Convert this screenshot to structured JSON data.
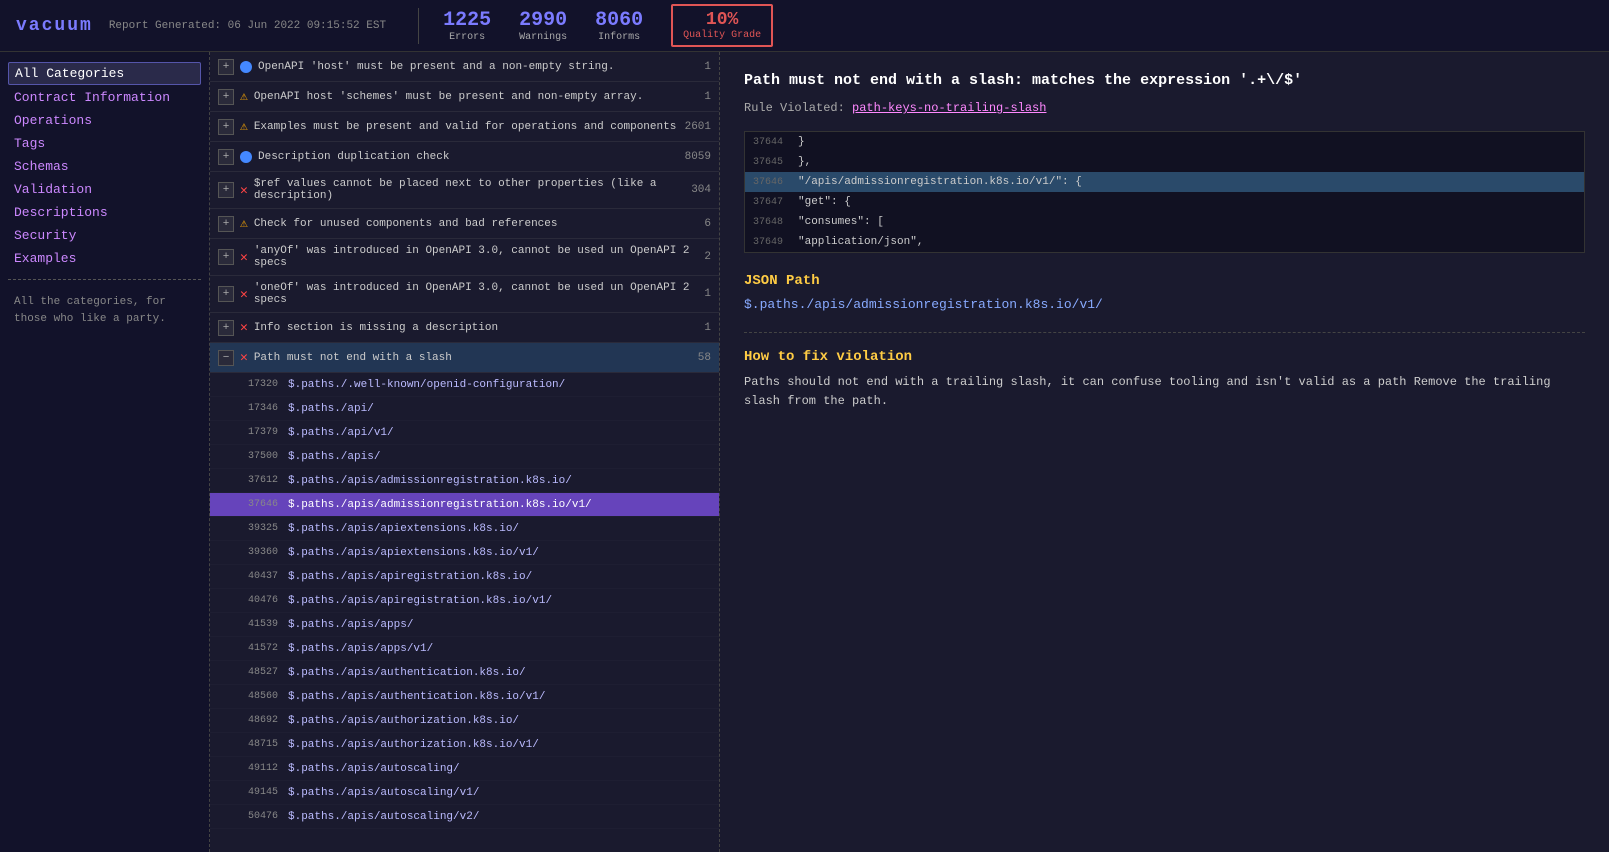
{
  "header": {
    "logo": "vacuum",
    "report_time": "Report Generated: 06 Jun 2022 09:15:52 EST",
    "stats": {
      "errors": {
        "number": "1225",
        "label": "Errors"
      },
      "warnings": {
        "number": "2990",
        "label": "Warnings"
      },
      "informs": {
        "number": "8060",
        "label": "Informs"
      },
      "quality": {
        "number": "10%",
        "label": "Quality Grade"
      }
    }
  },
  "sidebar": {
    "items": [
      {
        "id": "all-categories",
        "label": "All Categories",
        "active": true
      },
      {
        "id": "contract-information",
        "label": "Contract Information",
        "active": false
      },
      {
        "id": "operations",
        "label": "Operations",
        "active": false
      },
      {
        "id": "tags",
        "label": "Tags",
        "active": false
      },
      {
        "id": "schemas",
        "label": "Schemas",
        "active": false
      },
      {
        "id": "validation",
        "label": "Validation",
        "active": false
      },
      {
        "id": "descriptions",
        "label": "Descriptions",
        "active": false
      },
      {
        "id": "security",
        "label": "Security",
        "active": false
      },
      {
        "id": "examples",
        "label": "Examples",
        "active": false
      }
    ],
    "description": "All the categories, for those who like a party."
  },
  "rules": [
    {
      "id": "rule-host",
      "icon": "circle-blue",
      "text": "OpenAPI 'host' must be present and a non-empty string.",
      "count": "1",
      "expanded": false
    },
    {
      "id": "rule-schemes",
      "icon": "warn",
      "text": "OpenAPI host 'schemes' must be present and non-empty array.",
      "count": "1",
      "expanded": false
    },
    {
      "id": "rule-examples",
      "icon": "warn",
      "text": "Examples must be present and valid for operations and components",
      "count": "2601",
      "expanded": false
    },
    {
      "id": "rule-description-dup",
      "icon": "circle-blue",
      "text": "Description duplication check",
      "count": "8059",
      "expanded": false
    },
    {
      "id": "rule-ref",
      "icon": "error",
      "text": "$ref values cannot be placed next to other properties (like a description)",
      "count": "304",
      "expanded": false
    },
    {
      "id": "rule-unused",
      "icon": "warn",
      "text": "Check for unused components and bad references",
      "count": "6",
      "expanded": false
    },
    {
      "id": "rule-anyof",
      "icon": "error",
      "text": "'anyOf' was introduced in OpenAPI 3.0, cannot be used un OpenAPI 2 specs",
      "count": "2",
      "expanded": false
    },
    {
      "id": "rule-oneof",
      "icon": "error",
      "text": "'oneOf' was introduced in OpenAPI 3.0, cannot be used un OpenAPI 2 specs",
      "count": "1",
      "expanded": false
    },
    {
      "id": "rule-info-desc",
      "icon": "error",
      "text": "Info section is missing a description",
      "count": "1",
      "expanded": false
    },
    {
      "id": "rule-slash",
      "icon": "error",
      "text": "Path must not end with a slash",
      "count": "58",
      "expanded": true,
      "active": true
    }
  ],
  "subitems": [
    {
      "line": "17320",
      "path": "$.paths./.well-known/openid-configuration/",
      "selected": false
    },
    {
      "line": "17346",
      "path": "$.paths./api/",
      "selected": false
    },
    {
      "line": "17379",
      "path": "$.paths./api/v1/",
      "selected": false
    },
    {
      "line": "37500",
      "path": "$.paths./apis/",
      "selected": false
    },
    {
      "line": "37612",
      "path": "$.paths./apis/admissionregistration.k8s.io/",
      "selected": false
    },
    {
      "line": "37646",
      "path": "$.paths./apis/admissionregistration.k8s.io/v1/",
      "selected": true
    },
    {
      "line": "39325",
      "path": "$.paths./apis/apiextensions.k8s.io/",
      "selected": false
    },
    {
      "line": "39360",
      "path": "$.paths./apis/apiextensions.k8s.io/v1/",
      "selected": false
    },
    {
      "line": "40437",
      "path": "$.paths./apis/apiregistration.k8s.io/",
      "selected": false
    },
    {
      "line": "40476",
      "path": "$.paths./apis/apiregistration.k8s.io/v1/",
      "selected": false
    },
    {
      "line": "41539",
      "path": "$.paths./apis/apps/",
      "selected": false
    },
    {
      "line": "41572",
      "path": "$.paths./apis/apps/v1/",
      "selected": false
    },
    {
      "line": "48527",
      "path": "$.paths./apis/authentication.k8s.io/",
      "selected": false
    },
    {
      "line": "48560",
      "path": "$.paths./apis/authentication.k8s.io/v1/",
      "selected": false
    },
    {
      "line": "48692",
      "path": "$.paths./apis/authorization.k8s.io/",
      "selected": false
    },
    {
      "line": "48715",
      "path": "$.paths./apis/authorization.k8s.io/v1/",
      "selected": false
    },
    {
      "line": "49112",
      "path": "$.paths./apis/autoscaling/",
      "selected": false
    },
    {
      "line": "49145",
      "path": "$.paths./apis/autoscaling/v1/",
      "selected": false
    },
    {
      "line": "50476",
      "path": "$.paths./apis/autoscaling/v2/",
      "selected": false
    }
  ],
  "detail": {
    "title": "Path must not end with a slash: matches the expression '.+\\/$'",
    "rule_violated_label": "Rule Violated:",
    "rule_violated_link": "path-keys-no-trailing-slash",
    "code_lines": [
      {
        "ln": "37644",
        "code": "  }",
        "highlighted": false
      },
      {
        "ln": "37645",
        "code": "},",
        "highlighted": false
      },
      {
        "ln": "37646",
        "code": "\"/apis/admissionregistration.k8s.io/v1/\": {",
        "highlighted": true
      },
      {
        "ln": "37647",
        "code": "  \"get\": {",
        "highlighted": false
      },
      {
        "ln": "37648",
        "code": "    \"consumes\": [",
        "highlighted": false
      },
      {
        "ln": "37649",
        "code": "      \"application/json\",",
        "highlighted": false
      }
    ],
    "json_path_section": "JSON Path",
    "json_path_value": "$.paths./apis/admissionregistration.k8s.io/v1/",
    "how_to_fix_section": "How to fix violation",
    "how_to_fix_text": "Paths should not end with a trailing slash, it can confuse tooling and isn't valid as a path Remove the trailing slash from the path."
  }
}
